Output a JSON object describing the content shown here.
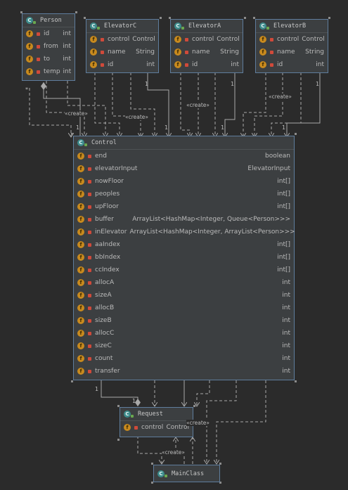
{
  "classes": {
    "person": {
      "name": "Person",
      "fields": [
        {
          "name": "id",
          "type": "int"
        },
        {
          "name": "from",
          "type": "int"
        },
        {
          "name": "to",
          "type": "int"
        },
        {
          "name": "temp",
          "type": "int"
        }
      ]
    },
    "elevatorC": {
      "name": "ElevatorC",
      "fields": [
        {
          "name": "control",
          "type": "Control"
        },
        {
          "name": "name",
          "type": "String"
        },
        {
          "name": "id",
          "type": "int"
        }
      ]
    },
    "elevatorA": {
      "name": "ElevatorA",
      "fields": [
        {
          "name": "control",
          "type": "Control"
        },
        {
          "name": "name",
          "type": "String"
        },
        {
          "name": "id",
          "type": "int"
        }
      ]
    },
    "elevatorB": {
      "name": "ElevatorB",
      "fields": [
        {
          "name": "control",
          "type": "Control"
        },
        {
          "name": "name",
          "type": "String"
        },
        {
          "name": "id",
          "type": "int"
        }
      ]
    },
    "control": {
      "name": "Control",
      "fields": [
        {
          "name": "end",
          "type": "boolean"
        },
        {
          "name": "elevatorInput",
          "type": "ElevatorInput"
        },
        {
          "name": "nowFloor",
          "type": "int[]"
        },
        {
          "name": "peoples",
          "type": "int[]"
        },
        {
          "name": "upFloor",
          "type": "int[]"
        },
        {
          "name": "buffer",
          "type": "ArrayList<HashMap<Integer, Queue<Person>>>"
        },
        {
          "name": "inElevator",
          "type": "ArrayList<HashMap<Integer, ArrayList<Person>>>"
        },
        {
          "name": "aaIndex",
          "type": "int[]"
        },
        {
          "name": "bbIndex",
          "type": "int[]"
        },
        {
          "name": "ccIndex",
          "type": "int[]"
        },
        {
          "name": "allocA",
          "type": "int"
        },
        {
          "name": "sizeA",
          "type": "int"
        },
        {
          "name": "allocB",
          "type": "int"
        },
        {
          "name": "sizeB",
          "type": "int"
        },
        {
          "name": "allocC",
          "type": "int"
        },
        {
          "name": "sizeC",
          "type": "int"
        },
        {
          "name": "count",
          "type": "int"
        },
        {
          "name": "transfer",
          "type": "int"
        }
      ]
    },
    "request": {
      "name": "Request",
      "fields": [
        {
          "name": "control",
          "type": "Control"
        }
      ]
    },
    "mainClass": {
      "name": "MainClass",
      "fields": []
    }
  },
  "labels": {
    "create": "«create»",
    "one": "1",
    "star": "*"
  },
  "icons": {
    "class": "class-icon",
    "field": "field-icon",
    "private": "lock-icon"
  },
  "colors": {
    "background": "#2b2b2b",
    "box": "#3c3f41",
    "border": "#5f7d9d",
    "line": "#a9a9a9",
    "classIcon": "#3d8c8c",
    "fieldIcon": "#c88a1e",
    "lockIcon": "#d04a3a"
  }
}
